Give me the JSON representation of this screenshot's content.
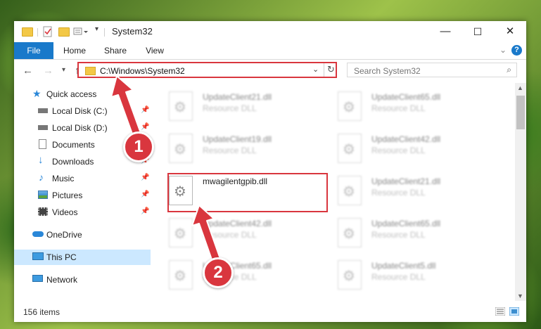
{
  "window": {
    "title": "System32",
    "controls": {
      "minimize": "—",
      "maximize": "☐",
      "close": "✕"
    }
  },
  "ribbon": {
    "tabs": [
      "File",
      "Home",
      "Share",
      "View"
    ],
    "help": "?"
  },
  "navbar": {
    "address": "C:\\Windows\\System32",
    "search_placeholder": "Search System32"
  },
  "sidebar": {
    "items": [
      {
        "label": "Quick access",
        "icon": "star-icon",
        "pinned": false
      },
      {
        "label": "Local Disk (C:)",
        "icon": "drive-icon",
        "pinned": true
      },
      {
        "label": "Local Disk (D:)",
        "icon": "drive-icon",
        "pinned": true
      },
      {
        "label": "Documents",
        "icon": "documents-icon",
        "pinned": true
      },
      {
        "label": "Downloads",
        "icon": "download-icon",
        "pinned": true
      },
      {
        "label": "Music",
        "icon": "music-icon",
        "pinned": true
      },
      {
        "label": "Pictures",
        "icon": "pictures-icon",
        "pinned": true
      },
      {
        "label": "Videos",
        "icon": "videos-icon",
        "pinned": true
      },
      {
        "label": "OneDrive",
        "icon": "cloud-icon",
        "pinned": false
      },
      {
        "label": "This PC",
        "icon": "computer-icon",
        "pinned": false,
        "selected": true
      },
      {
        "label": "Network",
        "icon": "network-icon",
        "pinned": false
      }
    ]
  },
  "files": [
    {
      "name": "UpdateClient21.dll",
      "type": "Resource DLL"
    },
    {
      "name": "UpdateClient65.dll",
      "type": "Resource DLL"
    },
    {
      "name": "UpdateClient19.dll",
      "type": "Resource DLL"
    },
    {
      "name": "UpdateClient42.dll",
      "type": "Resource DLL"
    },
    {
      "name": "mwagilentgpib.dll",
      "type": "",
      "highlighted": true
    },
    {
      "name": "UpdateClient21.dll",
      "type": "Resource DLL"
    },
    {
      "name": "UpdateClient42.dll",
      "type": "Resource DLL"
    },
    {
      "name": "UpdateClient65.dll",
      "type": "Resource DLL"
    },
    {
      "name": "UpdateClient65.dll",
      "type": "Resource DLL"
    },
    {
      "name": "UpdateClient5.dll",
      "type": "Resource DLL"
    }
  ],
  "status": {
    "item_count": "156 items"
  },
  "annotations": {
    "step1": "1",
    "step2": "2"
  },
  "colors": {
    "accent": "#1979ca",
    "highlight": "#d9363e",
    "selection": "#cce8ff"
  }
}
